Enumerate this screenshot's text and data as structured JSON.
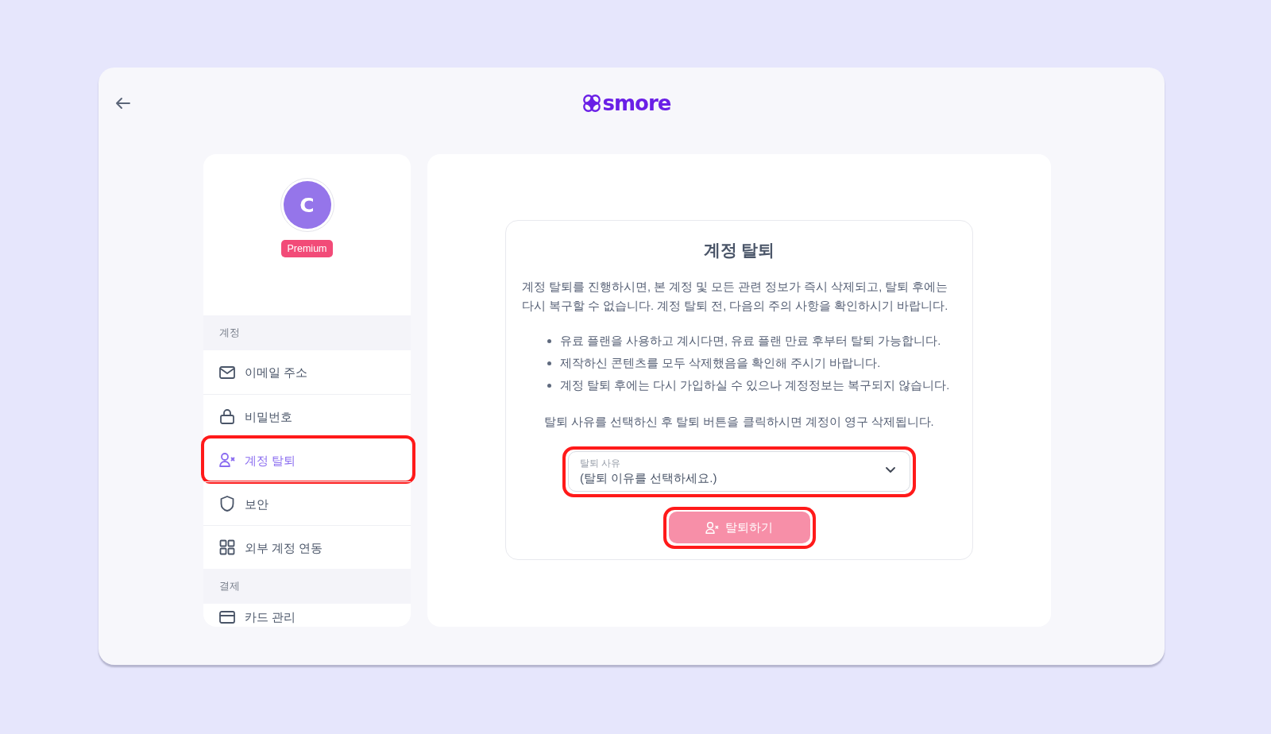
{
  "logo": {
    "text": "smore"
  },
  "profile": {
    "initial": "C",
    "badge": "Premium"
  },
  "sidebar": {
    "sections": [
      {
        "title": "계정",
        "items": [
          {
            "label": "이메일 주소",
            "selected": false,
            "highlighted": false
          },
          {
            "label": "비밀번호",
            "selected": false,
            "highlighted": false
          },
          {
            "label": "계정 탈퇴",
            "selected": true,
            "highlighted": true
          },
          {
            "label": "보안",
            "selected": false,
            "highlighted": false
          },
          {
            "label": "외부 계정 연동",
            "selected": false,
            "highlighted": false
          }
        ]
      },
      {
        "title": "결제",
        "items": [
          {
            "label": "카드 관리",
            "selected": false,
            "highlighted": false
          }
        ]
      }
    ]
  },
  "withdrawal": {
    "title": "계정 탈퇴",
    "intro": "계정 탈퇴를 진행하시면, 본 계정 및 모든 관련 정보가 즉시 삭제되고, 탈퇴 후에는 다시 복구할 수 없습니다. 계정 탈퇴 전, 다음의 주의 사항을 확인하시기 바랍니다.",
    "notices": [
      "유료 플랜을 사용하고 계시다면, 유료 플랜 만료 후부터 탈퇴 가능합니다.",
      "제작하신 콘텐츠를 모두 삭제했음을 확인해 주시기 바랍니다.",
      "계정 탈퇴 후에는 다시 가입하실 수 있으나 계정정보는 복구되지 않습니다."
    ],
    "instruction": "탈퇴 사유를 선택하신 후 탈퇴 버튼을 클릭하시면 계정이 영구 삭제됩니다.",
    "reason_select": {
      "label": "탈퇴 사유",
      "value": "(탈퇴 이유를 선택하세요.)",
      "highlighted": true
    },
    "submit_button": {
      "label": "탈퇴하기",
      "disabled": true,
      "highlighted": true
    }
  }
}
